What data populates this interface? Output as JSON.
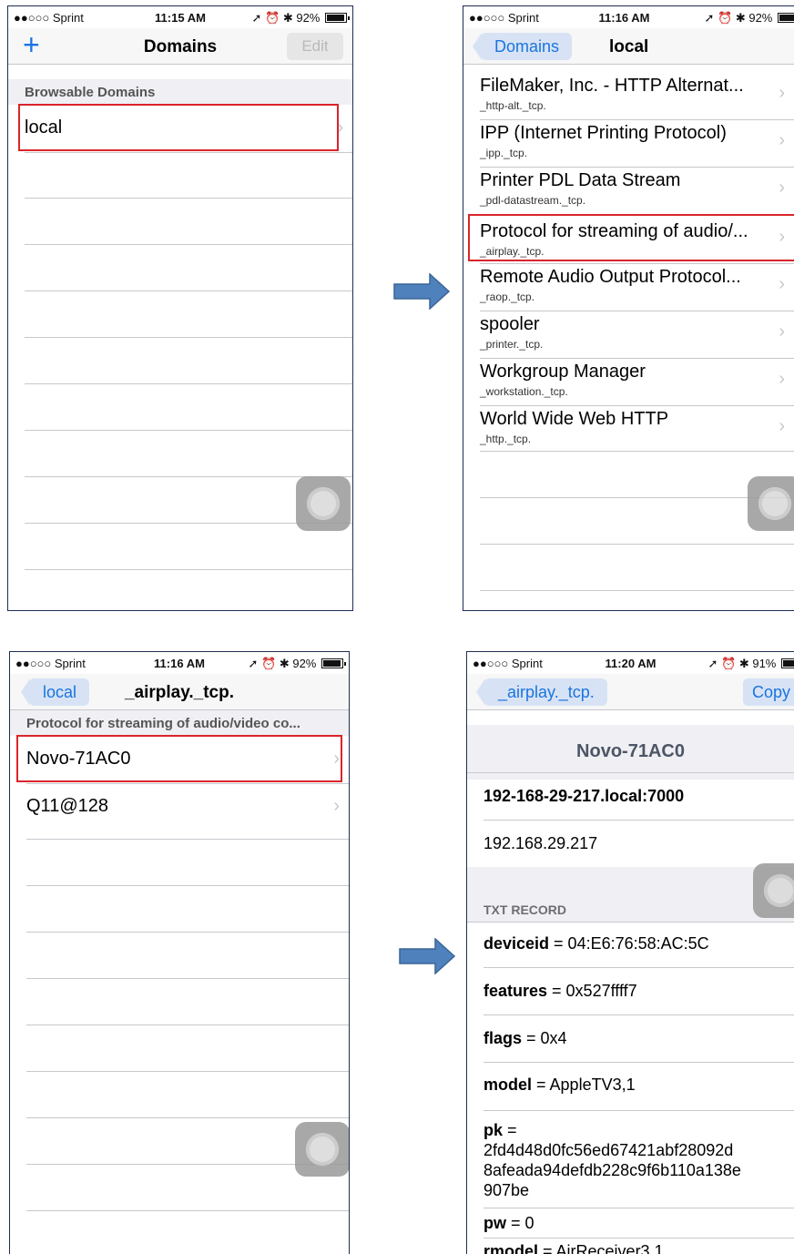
{
  "status_bars": [
    {
      "carrier": "●●○○○ Sprint",
      "time": "11:15 AM",
      "battery": "92%"
    },
    {
      "carrier": "●●○○○ Sprint",
      "time": "11:16 AM",
      "battery": "92%"
    },
    {
      "carrier": "●●○○○ Sprint",
      "time": "11:16 AM",
      "battery": "92%"
    },
    {
      "carrier": "●●○○○ Sprint",
      "time": "11:20 AM",
      "battery": "91%"
    }
  ],
  "screen1": {
    "add_label": "+",
    "title": "Domains",
    "edit_label": "Edit",
    "section": "Browsable Domains",
    "items": [
      {
        "label": "local"
      }
    ]
  },
  "screen2": {
    "back_label": "Domains",
    "title": "local",
    "services": [
      {
        "name": "FileMaker, Inc. - HTTP Alternat...",
        "type": "_http-alt._tcp."
      },
      {
        "name": "IPP (Internet Printing Protocol)",
        "type": "_ipp._tcp."
      },
      {
        "name": "Printer PDL Data Stream",
        "type": "_pdl-datastream._tcp."
      },
      {
        "name": "Protocol for streaming of audio/...",
        "type": "_airplay._tcp."
      },
      {
        "name": "Remote Audio Output Protocol...",
        "type": "_raop._tcp."
      },
      {
        "name": "spooler",
        "type": "_printer._tcp."
      },
      {
        "name": "Workgroup Manager",
        "type": "_workstation._tcp."
      },
      {
        "name": "World Wide Web HTTP",
        "type": "_http._tcp."
      }
    ]
  },
  "screen3": {
    "back_label": "local",
    "title": "_airplay._tcp.",
    "section": "Protocol for streaming of audio/video co...",
    "devices": [
      {
        "label": "Novo-71AC0"
      },
      {
        "label": "Q11@128"
      }
    ]
  },
  "screen4": {
    "back_label": "_airplay._tcp.",
    "copy_label": "Copy",
    "device_name": "Novo-71AC0",
    "host": "192-168-29-217.local:7000",
    "ip": "192.168.29.217",
    "txt_header": "TXT RECORD",
    "records": [
      {
        "key": "deviceid",
        "value": " = 04:E6:76:58:AC:5C"
      },
      {
        "key": "features",
        "value": " = 0x527ffff7"
      },
      {
        "key": "flags",
        "value": " = 0x4"
      },
      {
        "key": "model",
        "value": " = AppleTV3,1"
      },
      {
        "key": "pk",
        "value": " =",
        "extra": [
          "2fd4d48d0fc56ed67421abf28092d",
          "8afeada94defdb228c9f6b110a138e",
          "907be"
        ]
      },
      {
        "key": "pw",
        "value": " = 0"
      },
      {
        "key": "rmodel",
        "value": " = AirReceiver3,1"
      }
    ]
  },
  "colors": {
    "highlight": "#d9252a",
    "ios_blue": "#1a74e0",
    "arrow_fill": "#4f81bd",
    "frame": "#1f2d52"
  }
}
